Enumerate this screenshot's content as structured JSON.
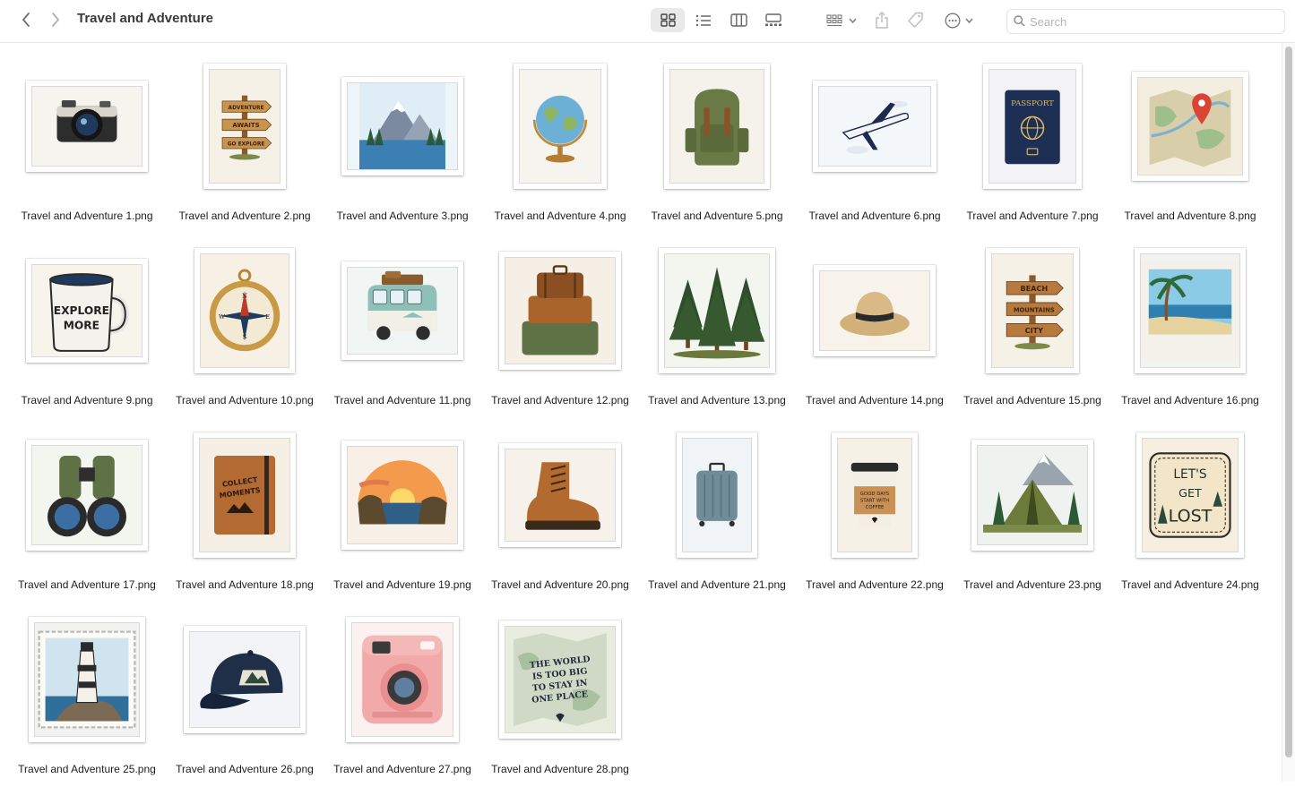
{
  "window": {
    "title": "Travel and Adventure",
    "search_placeholder": "Search",
    "view_mode": "icons"
  },
  "files": [
    {
      "name": "Travel and Adventure 1.png",
      "icon": "camera-icon"
    },
    {
      "name": "Travel and Adventure 2.png",
      "icon": "signpost-icon",
      "texts": [
        "ADVENTURE",
        "AWAITS",
        "GO EXPLORE"
      ]
    },
    {
      "name": "Travel and Adventure 3.png",
      "icon": "mountain-lake-icon"
    },
    {
      "name": "Travel and Adventure 4.png",
      "icon": "globe-icon"
    },
    {
      "name": "Travel and Adventure 5.png",
      "icon": "backpack-icon"
    },
    {
      "name": "Travel and Adventure 6.png",
      "icon": "airplane-icon"
    },
    {
      "name": "Travel and Adventure 7.png",
      "icon": "passport-icon",
      "texts": [
        "PASSPORT"
      ]
    },
    {
      "name": "Travel and Adventure 8.png",
      "icon": "map-pin-icon"
    },
    {
      "name": "Travel and Adventure 9.png",
      "icon": "mug-icon",
      "texts": [
        "EXPLORE",
        "MORE"
      ]
    },
    {
      "name": "Travel and Adventure 10.png",
      "icon": "compass-icon",
      "texts": [
        "N",
        "E",
        "S",
        "W"
      ]
    },
    {
      "name": "Travel and Adventure 11.png",
      "icon": "camper-van-icon"
    },
    {
      "name": "Travel and Adventure 12.png",
      "icon": "suitcases-icon"
    },
    {
      "name": "Travel and Adventure 13.png",
      "icon": "pine-trees-icon"
    },
    {
      "name": "Travel and Adventure 14.png",
      "icon": "hat-icon"
    },
    {
      "name": "Travel and Adventure 15.png",
      "icon": "signpost-icon",
      "texts": [
        "BEACH",
        "MOUNTAINS",
        "CITY"
      ]
    },
    {
      "name": "Travel and Adventure 16.png",
      "icon": "beach-photo-icon"
    },
    {
      "name": "Travel and Adventure 17.png",
      "icon": "binoculars-icon"
    },
    {
      "name": "Travel and Adventure 18.png",
      "icon": "journal-icon",
      "texts": [
        "COLLECT",
        "MOMENTS"
      ]
    },
    {
      "name": "Travel and Adventure 19.png",
      "icon": "sunset-icon"
    },
    {
      "name": "Travel and Adventure 20.png",
      "icon": "boot-icon"
    },
    {
      "name": "Travel and Adventure 21.png",
      "icon": "luggage-icon"
    },
    {
      "name": "Travel and Adventure 22.png",
      "icon": "coffee-cup-icon",
      "texts": [
        "GOOD DAYS",
        "START WITH",
        "COFFEE"
      ]
    },
    {
      "name": "Travel and Adventure 23.png",
      "icon": "tent-icon"
    },
    {
      "name": "Travel and Adventure 24.png",
      "icon": "lets-get-lost-icon",
      "texts": [
        "LET'S",
        "GET",
        "LOST"
      ]
    },
    {
      "name": "Travel and Adventure 25.png",
      "icon": "lighthouse-stamp-icon"
    },
    {
      "name": "Travel and Adventure 26.png",
      "icon": "cap-icon"
    },
    {
      "name": "Travel and Adventure 27.png",
      "icon": "instant-camera-icon"
    },
    {
      "name": "Travel and Adventure 28.png",
      "icon": "world-map-quote-icon",
      "texts": [
        "THE WORLD",
        "IS TOO BIG",
        "TO STAY IN",
        "ONE PLACE"
      ]
    }
  ]
}
